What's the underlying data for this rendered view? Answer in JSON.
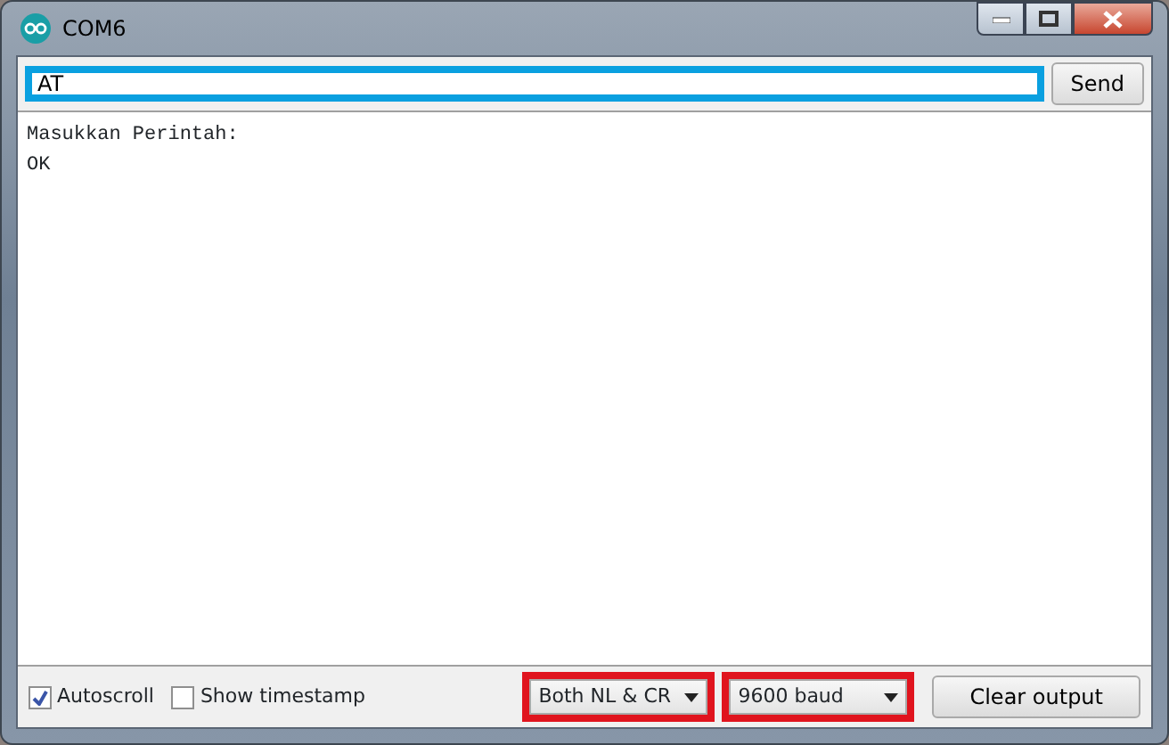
{
  "window": {
    "title": "COM6"
  },
  "input": {
    "value": "AT"
  },
  "send_button": "Send",
  "output": [
    "Masukkan Perintah:",
    "OK"
  ],
  "options": [
    {
      "label": "Autoscroll",
      "checked": true
    },
    {
      "label": "Show timestamp",
      "checked": false
    }
  ],
  "line_ending": {
    "value": "Both NL & CR"
  },
  "baud_rate": {
    "value": "9600 baud"
  },
  "clear_button": "Clear output"
}
